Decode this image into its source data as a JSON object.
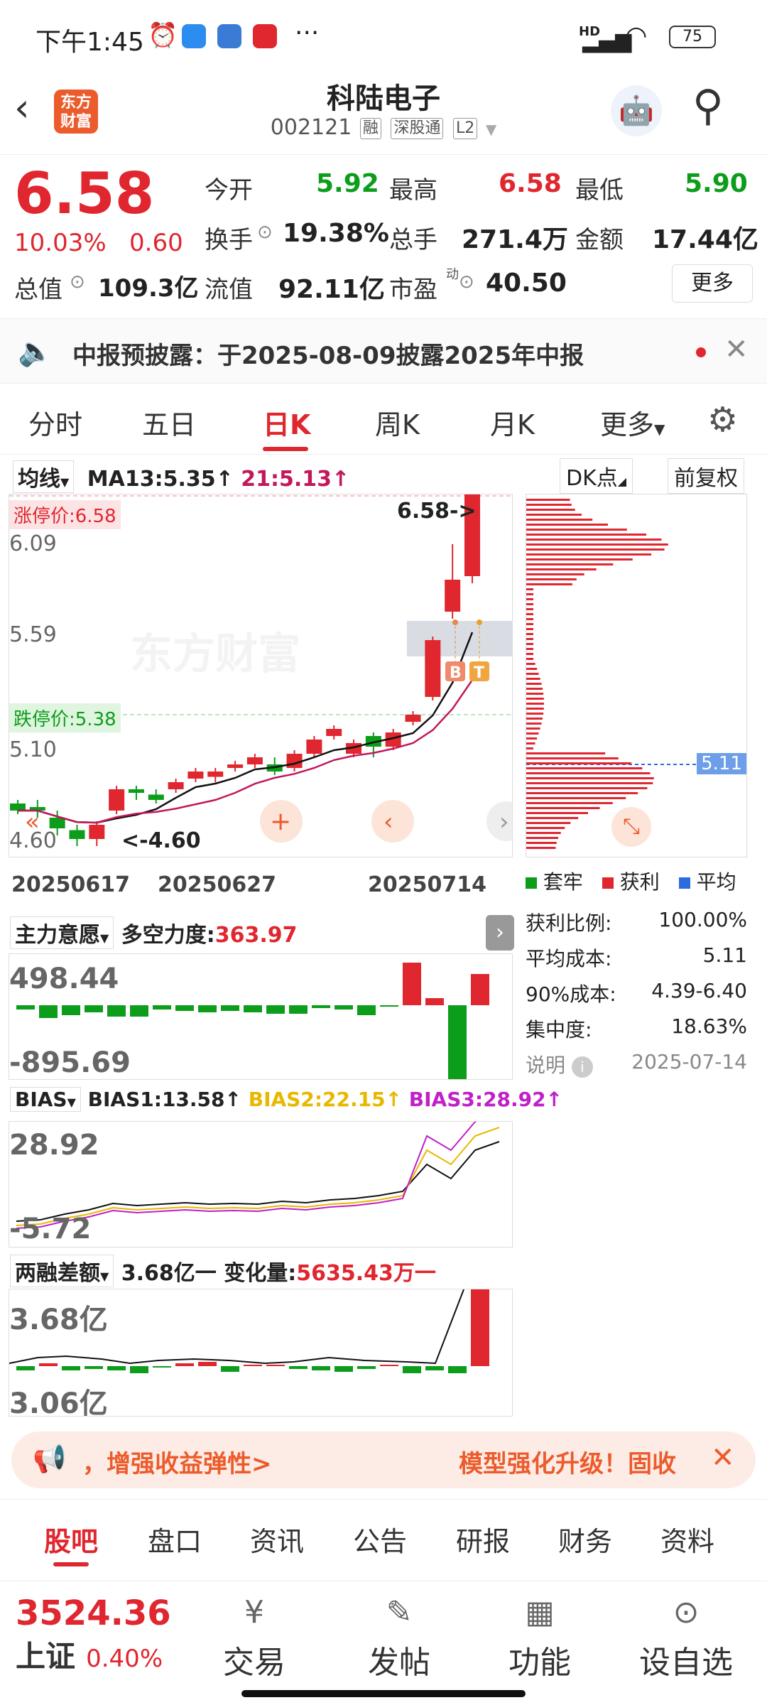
{
  "status": {
    "time": "下午1:45",
    "battery": "75",
    "network": "HD"
  },
  "header": {
    "logo": "东方财富",
    "name": "科陆电子",
    "code": "002121",
    "badges": [
      "融",
      "深股通",
      "L2"
    ]
  },
  "quote": {
    "price": "6.58",
    "change_pct": "10.03%",
    "change": "0.60",
    "open_label": "今开",
    "open": "5.92",
    "high_label": "最高",
    "high": "6.58",
    "low_label": "最低",
    "low": "5.90",
    "turnover_label": "换手",
    "turnover": "19.38%",
    "volume_label": "总手",
    "volume": "271.4万",
    "amount_label": "金额",
    "amount": "17.44亿",
    "mcap_label": "总值",
    "mcap": "109.3亿",
    "float_label": "流值",
    "float": "92.11亿",
    "pe_label": "市盈",
    "pe_super": "动",
    "pe": "40.50",
    "more": "更多"
  },
  "notice": {
    "text": "中报预披露：于2025-08-09披露2025年中报"
  },
  "tabs": [
    "分时",
    "五日",
    "日K",
    "周K",
    "月K",
    "更多"
  ],
  "kline": {
    "ma_dropdown": "均线",
    "ma13": "MA13:5.35↑",
    "ma21": "21:5.13↑",
    "dk": "DK点",
    "fq": "前复权",
    "limit_up": "涨停价:6.58",
    "limit_down": "跌停价:5.38",
    "y_labels": [
      "6.58",
      "6.09",
      "5.59",
      "5.10",
      "4.60"
    ],
    "x_labels": [
      "20250617",
      "20250627",
      "20250714"
    ],
    "last_label": "6.58->",
    "low_label": "<-4.60",
    "watermark": "东方财富",
    "b": "B",
    "t": "T"
  },
  "chip": {
    "avg_tag": "5.11",
    "legend": [
      "套牢",
      "获利",
      "平均"
    ],
    "rows": [
      {
        "label": "获利比例:",
        "value": "100.00%"
      },
      {
        "label": "平均成本:",
        "value": "5.11"
      },
      {
        "label": "90%成本:",
        "value": "4.39-6.40"
      },
      {
        "label": "集中度:",
        "value": "18.63%"
      }
    ],
    "note": "说明",
    "date": "2025-07-14"
  },
  "ind1": {
    "dropdown": "主力意愿",
    "title": "多空力度:",
    "value": "363.97",
    "top": "498.44",
    "bottom": "-895.69"
  },
  "ind2": {
    "dropdown": "BIAS",
    "b1": "BIAS1:13.58↑",
    "b2": "BIAS2:22.15↑",
    "b3": "BIAS3:28.92↑",
    "top": "28.92",
    "bottom": "-5.72"
  },
  "ind3": {
    "dropdown": "两融差额",
    "v1": "3.68亿一",
    "label": "变化量:",
    "v2": "5635.43万一",
    "top": "3.68亿",
    "bottom": "3.06亿"
  },
  "promo": {
    "text1": "，增强收益弹性>",
    "text2": "模型强化升级！固收"
  },
  "bottomnav": [
    "股吧",
    "盘口",
    "资讯",
    "公告",
    "研报",
    "财务",
    "资料"
  ],
  "footer": {
    "index_value": "3524.36",
    "index_name": "上证",
    "index_pct": "0.40%",
    "items": [
      "交易",
      "发帖",
      "功能",
      "设自选"
    ]
  },
  "colors": {
    "red": "#e0262f",
    "green": "#0c9d1b",
    "accent": "#ec5b2c"
  }
}
